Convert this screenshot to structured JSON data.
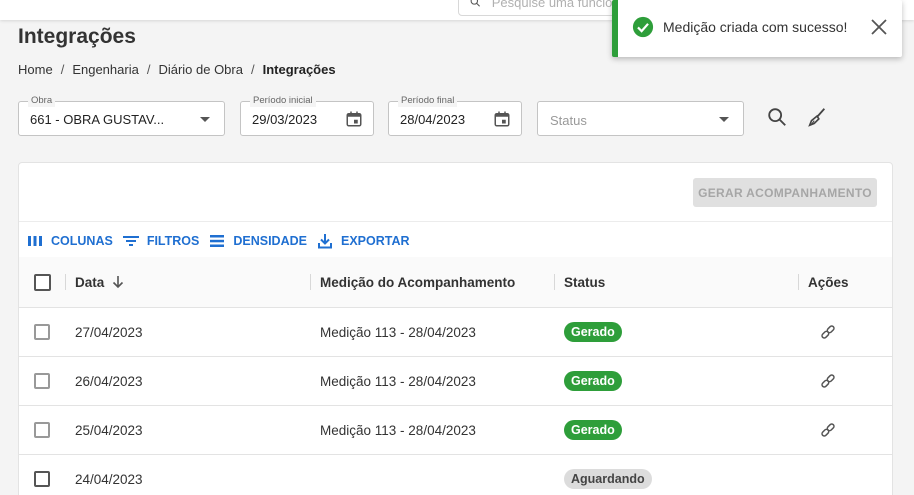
{
  "search": {
    "placeholder": "Pesquise uma funcionalidade"
  },
  "page": {
    "title": "Integrações"
  },
  "breadcrumb": {
    "items": [
      "Home",
      "Engenharia",
      "Diário de Obra",
      "Integrações"
    ]
  },
  "filters": {
    "obra": {
      "label": "Obra",
      "value": "661 - OBRA GUSTAV..."
    },
    "periodo_inicial": {
      "label": "Período inicial",
      "value": "29/03/2023"
    },
    "periodo_final": {
      "label": "Período final",
      "value": "28/04/2023"
    },
    "status": {
      "placeholder": "Status"
    }
  },
  "actions": {
    "generate_label": "GERAR ACOMPANHAMENTO"
  },
  "grid_toolbar": {
    "columns": "COLUNAS",
    "filters": "FILTROS",
    "density": "DENSIDADE",
    "export": "EXPORTAR"
  },
  "table": {
    "headers": {
      "data": "Data",
      "medicao": "Medição do Acompanhamento",
      "status": "Status",
      "acoes": "Ações"
    },
    "rows": [
      {
        "data": "27/04/2023",
        "medicao": "Medição 113 - 28/04/2023",
        "status": "Gerado"
      },
      {
        "data": "26/04/2023",
        "medicao": "Medição 113 - 28/04/2023",
        "status": "Gerado"
      },
      {
        "data": "25/04/2023",
        "medicao": "Medição 113 - 28/04/2023",
        "status": "Gerado"
      },
      {
        "data": "24/04/2023",
        "medicao": "",
        "status": "Aguardando"
      }
    ]
  },
  "toast": {
    "message": "Medição criada com sucesso!"
  },
  "colors": {
    "primary": "#1f6fd1",
    "success": "#2e9e3a",
    "pending": "#dcdcdc"
  },
  "icons": [
    "search-icon",
    "calendar-icon",
    "broom-icon",
    "link-icon",
    "columns-icon",
    "filter-icon",
    "density-icon",
    "export-icon",
    "check-circle-icon",
    "close-icon",
    "sort-down-icon"
  ]
}
